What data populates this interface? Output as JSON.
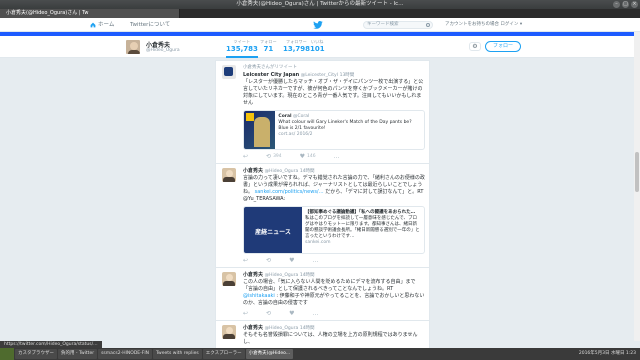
{
  "window": {
    "title": "小倉秀夫(@Hideo_Ogura)さん | Twitterからの最新ツイート - Ic…"
  },
  "browser": {
    "tabs": [
      {
        "label": "小倉秀夫(@Hideo_Ogura)さん | Tw",
        "active": true
      }
    ],
    "url": "小倉秀夫(@Hideo_Ogura)さん | Twitterからの最新ツイート"
  },
  "navbar": {
    "home_label": "ホーム",
    "about_label": "Twitterについて",
    "search_placeholder": "キーワード検索",
    "signup_text": "アカウントをお持ちの場合 ログイン ▾"
  },
  "profile": {
    "name": "小倉秀夫",
    "handle": "@Hideo_Ogura",
    "stats": [
      {
        "label": "ツイート",
        "value": "135,783"
      },
      {
        "label": "フォロー",
        "value": "71"
      },
      {
        "label": "フォロワー",
        "value": "13,798"
      },
      {
        "label": "いいね",
        "value": "101"
      }
    ],
    "follow_label": "フォロー",
    "gear_glyph": "⚙"
  },
  "tweets": [
    {
      "context": "小倉秀夫さんがリツイート",
      "name": "Leicester City Japan",
      "handle": "@Leicester_Cityl",
      "time": "13時間",
      "text": "「レスターが優勝したらマッチ・オブ・ザ・デイにパンツ一枚で出演する」と公言していたリネカーですが、彼が何色のパンツを穿くかブックメーカーが賭けの対象にしています。現在のところ青が一番人気です。注目してもいいかもしれません",
      "card": {
        "title": "Coral",
        "handle": "@Coral",
        "body": "What colour will Gary Lineker's Match of the Day pants be? Blue is 2/1 favourite!",
        "source": "cort.as/ 2016/2"
      },
      "actions": {
        "reply": "",
        "retweet": "394",
        "like": "146"
      }
    },
    {
      "context": "",
      "name": "小倉秀夫",
      "handle": "@Hideo_Ogura",
      "time": "14時間",
      "text": "言論の力って凄いですね。デマも錯覚された言論の力で、「緒利さんのお便様の政書」という成果が得られれば、ジャーナリストとしては最近らしいことでしょうね。",
      "link": "sankei.com/politics/news/…",
      "text2": " だから、「デマに対して誤訂なんて」と。RT @Yu_TERASAWA:",
      "card": {
        "image_label": "産経ニュース",
        "title": "【都知事めぐる議論動議】「私への闘議をあおられた…",
        "body": "私はこのブログを拝読して一層意味を感じたんで、ブログはやはりモットーに限ります。都知事さんは、緒日新聞の懇談学術議会長所。「緒日新聞懇る選別で一年の」と言ったというわけです…",
        "source": "sankei.com"
      },
      "actions": {
        "reply": "",
        "retweet": "",
        "like": ""
      }
    },
    {
      "context": "",
      "name": "小倉秀夫",
      "handle": "@Hideo_Ogura",
      "time": "14時間",
      "text": "この人の場合、「気に入らない人間を貶めるためにデマを流布する自由」まで「言論の自由」として保護されるべきってことなんでしょうね。RT",
      "mention": "@ishitakaaki",
      "text2": ": 伊藤和子や神原元がやってることを、言論でおかしいと思わないのか、言論の自由の侵害です",
      "actions": {
        "reply": "",
        "retweet": "",
        "like": ""
      }
    },
    {
      "context": "",
      "name": "小倉秀夫",
      "handle": "@Hideo_Ogura",
      "time": "14時間",
      "text": "そもそも名誉毀損罪については、人権の立場を上方の原則規程ではありませんし、",
      "actions": {
        "reply": "",
        "retweet": "",
        "like": ""
      }
    }
  ],
  "status_url": "https://twitter.com/Hideo_Ogura/status/…",
  "taskbar": {
    "items": [
      {
        "label": "カスタブラウザー",
        "active": false
      },
      {
        "label": "負的用 - Twitter",
        "active": false
      },
      {
        "label": "ssmacs2-HINODE-FIN",
        "active": false
      },
      {
        "label": "Tweets with replies",
        "active": false
      },
      {
        "label": "エクスプローラー",
        "active": false
      },
      {
        "label": "小倉秀夫(@Hideo...",
        "active": true
      },
      {
        "label": "",
        "active": false
      }
    ],
    "clock": "2016年5月3日 水曜日 1:23"
  },
  "colors": {
    "accent": "#1da1f2",
    "banner": "#1d5bff"
  }
}
